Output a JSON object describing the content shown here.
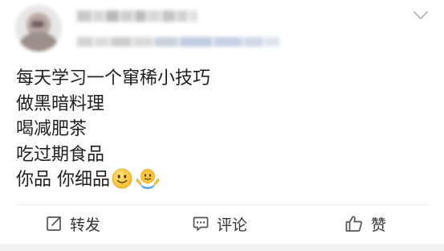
{
  "post": {
    "lines": [
      "每天学习一个窜稀小技巧",
      "做黑暗料理",
      "喝减肥茶",
      "吃过期食品",
      "你品 你细品"
    ],
    "emojis": [
      "smile-emoji",
      "shrug-emoji"
    ]
  },
  "actions": {
    "repost": {
      "label": "转发",
      "icon": "share-icon"
    },
    "comment": {
      "label": "评论",
      "icon": "comment-icon"
    },
    "like": {
      "label": "赞",
      "icon": "thumbs-up-icon"
    }
  },
  "colors": {
    "text": "#1f1f1f",
    "icon": "#555555",
    "divider": "#ececec",
    "background": "#ffffff",
    "footer": "#f2f2f2",
    "emoji_face": "#f7c53b"
  }
}
